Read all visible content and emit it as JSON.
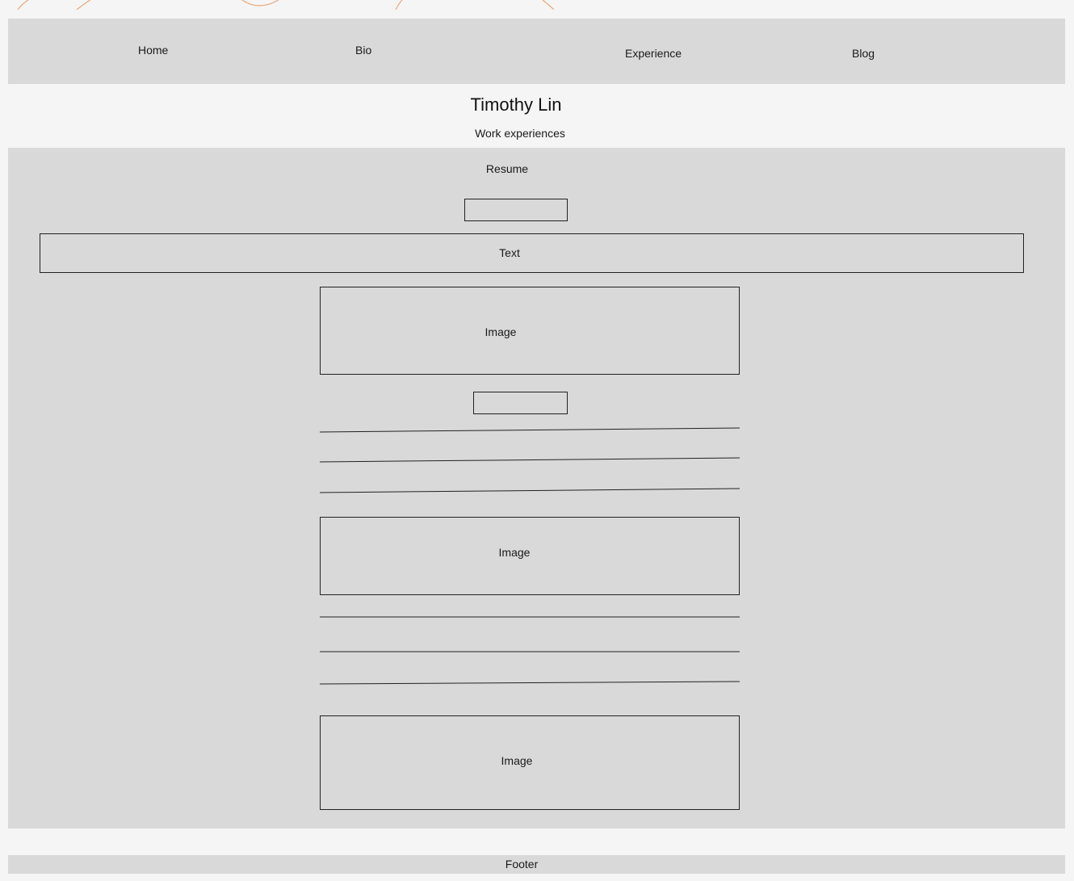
{
  "nav": {
    "home": "Home",
    "bio": "Bio",
    "experience": "Experience",
    "blog": "Blog"
  },
  "header": {
    "title": "Timothy Lin",
    "subtitle": "Work experiences"
  },
  "main": {
    "resume_label": "Resume",
    "text_label": "Text",
    "image_labels": [
      "Image",
      "Image",
      "Image"
    ]
  },
  "footer": {
    "label": "Footer"
  },
  "colors": {
    "page_bg": "#f5f5f5",
    "panel_bg": "#d9d9d9",
    "stroke": "#222222",
    "decor_orange": "#e8a77a"
  }
}
